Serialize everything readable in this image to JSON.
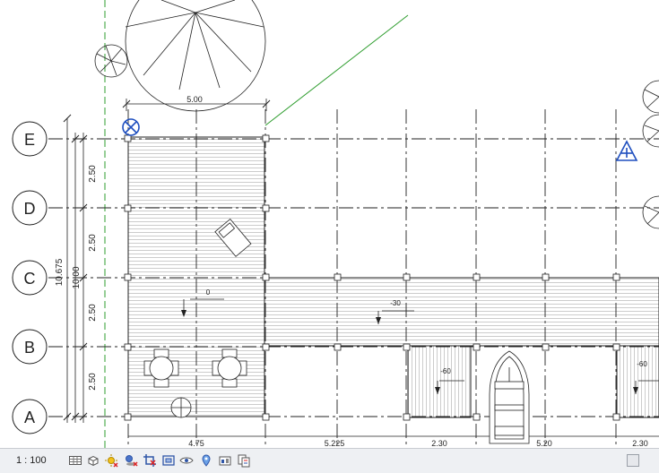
{
  "grid_bubbles": [
    "E",
    "D",
    "C",
    "B",
    "A"
  ],
  "dims": {
    "top_width": "5.00",
    "row_spacing": [
      "2.50",
      "2.50",
      "2.50",
      "2.50"
    ],
    "total_inner": "10.00",
    "total_outer": "10.675",
    "bottom": [
      "4.75",
      "5.225",
      "2.30",
      "5.20",
      "2.30"
    ]
  },
  "levels": {
    "main_deck": "0",
    "walkway": "-30",
    "slip_left": "-60",
    "slip_right": "-60"
  },
  "statusbar": {
    "scale": "1 : 100"
  },
  "icons": [
    "detail-level-icon",
    "visual-style-icon",
    "sun-path-icon",
    "shadows-icon",
    "crop-view-icon",
    "show-crop-icon",
    "temporary-hide-icon",
    "reveal-hidden-icon",
    "analytics-icon",
    "worksharing-icon"
  ]
}
